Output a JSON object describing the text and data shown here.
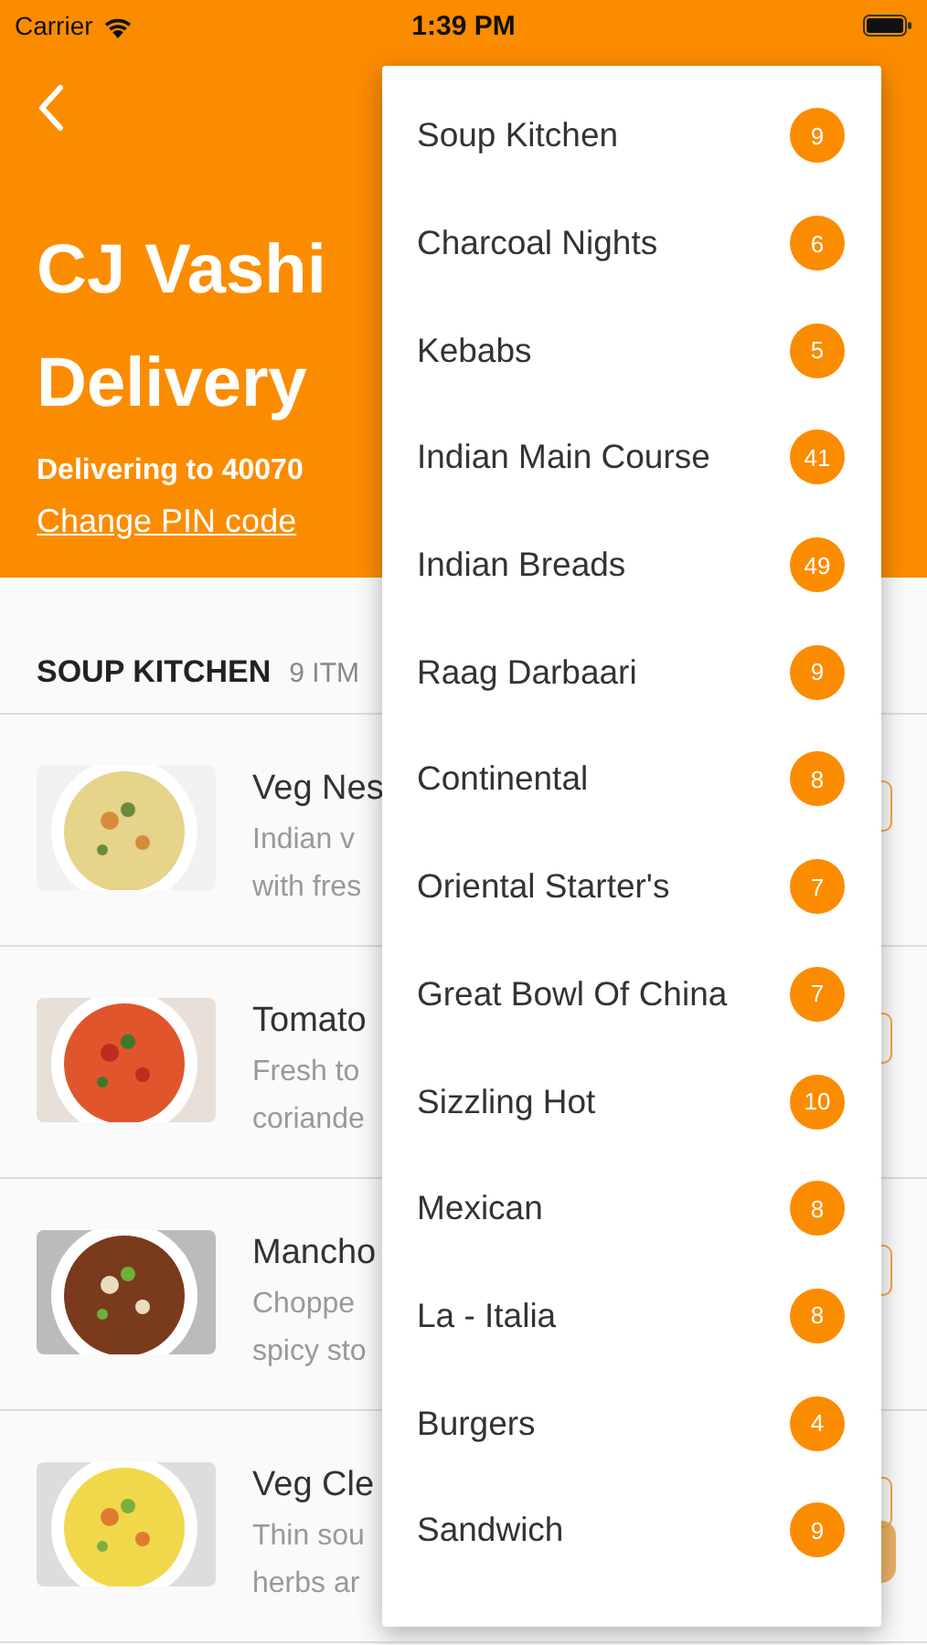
{
  "status_bar": {
    "carrier": "Carrier",
    "time": "1:39 PM"
  },
  "header": {
    "title_lines": [
      "CJ Vashi",
      "Delivery"
    ],
    "delivery_text": "Delivering to 40070",
    "change_pin_link": "Change PIN code"
  },
  "section": {
    "title": "SOUP KITCHEN",
    "count": "9 ITM"
  },
  "items": [
    {
      "name": "Veg Nes",
      "description_lines": [
        "Indian v",
        "with fres"
      ]
    },
    {
      "name": "Tomato",
      "description_lines": [
        "Fresh to",
        "coriande"
      ]
    },
    {
      "name": "Mancho",
      "description_lines": [
        "Choppe",
        "spicy sto"
      ]
    },
    {
      "name": "Veg Cle",
      "description_lines": [
        "Thin sou",
        "herbs ar"
      ]
    }
  ],
  "menu": {
    "categories": [
      {
        "name": "Soup Kitchen",
        "count": "9"
      },
      {
        "name": "Charcoal Nights",
        "count": "6"
      },
      {
        "name": "Kebabs",
        "count": "5"
      },
      {
        "name": "Indian Main Course",
        "count": "41"
      },
      {
        "name": "Indian Breads",
        "count": "49"
      },
      {
        "name": "Raag Darbaari",
        "count": "9"
      },
      {
        "name": "Continental",
        "count": "8"
      },
      {
        "name": "Oriental Starter's",
        "count": "7"
      },
      {
        "name": "Great Bowl Of China",
        "count": "7"
      },
      {
        "name": "Sizzling Hot",
        "count": "10"
      },
      {
        "name": "Mexican",
        "count": "8"
      },
      {
        "name": "La - Italia",
        "count": "8"
      },
      {
        "name": "Burgers",
        "count": "4"
      },
      {
        "name": "Sandwich",
        "count": "9"
      }
    ]
  }
}
